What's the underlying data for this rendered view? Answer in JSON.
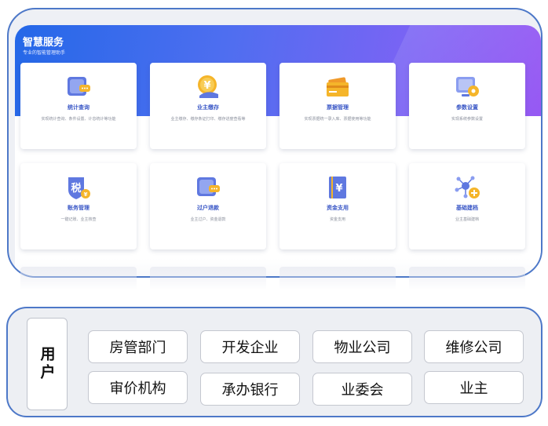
{
  "header": {
    "title": "智慧服务",
    "subtitle": "专业的智能管理助手"
  },
  "services": [
    {
      "title": "统计查询",
      "desc": "实现统计查询、条件设置、计息统计等功能",
      "icon": "stats-icon"
    },
    {
      "title": "业主缴存",
      "desc": "业主缴存、缴存条证打印、缴存进度查看等",
      "icon": "yuan-coin-icon"
    },
    {
      "title": "票据管理",
      "desc": "实现票据统一录入库、票据使用等功能",
      "icon": "ticket-icon"
    },
    {
      "title": "参数设置",
      "desc": "实现系统参数设置",
      "icon": "settings-icon"
    },
    {
      "title": "账务管理",
      "desc": "一键记账、业主核查",
      "icon": "tax-shield-icon"
    },
    {
      "title": "过户退款",
      "desc": "业主过户、资金退款",
      "icon": "refund-card-icon"
    },
    {
      "title": "资金支用",
      "desc": "资金支用",
      "icon": "ledger-yuan-icon"
    },
    {
      "title": "基础建档",
      "desc": "业主基础建档",
      "icon": "network-add-icon"
    }
  ],
  "users": {
    "label": "用户",
    "items": [
      "房管部门",
      "开发企业",
      "物业公司",
      "维修公司",
      "审价机构",
      "承办银行",
      "业委会",
      "业主"
    ]
  },
  "colors": {
    "accent": "#3a57c6",
    "gradient_start": "#2468e8",
    "gradient_end": "#9657f3",
    "frame_border": "#4d78c8"
  }
}
